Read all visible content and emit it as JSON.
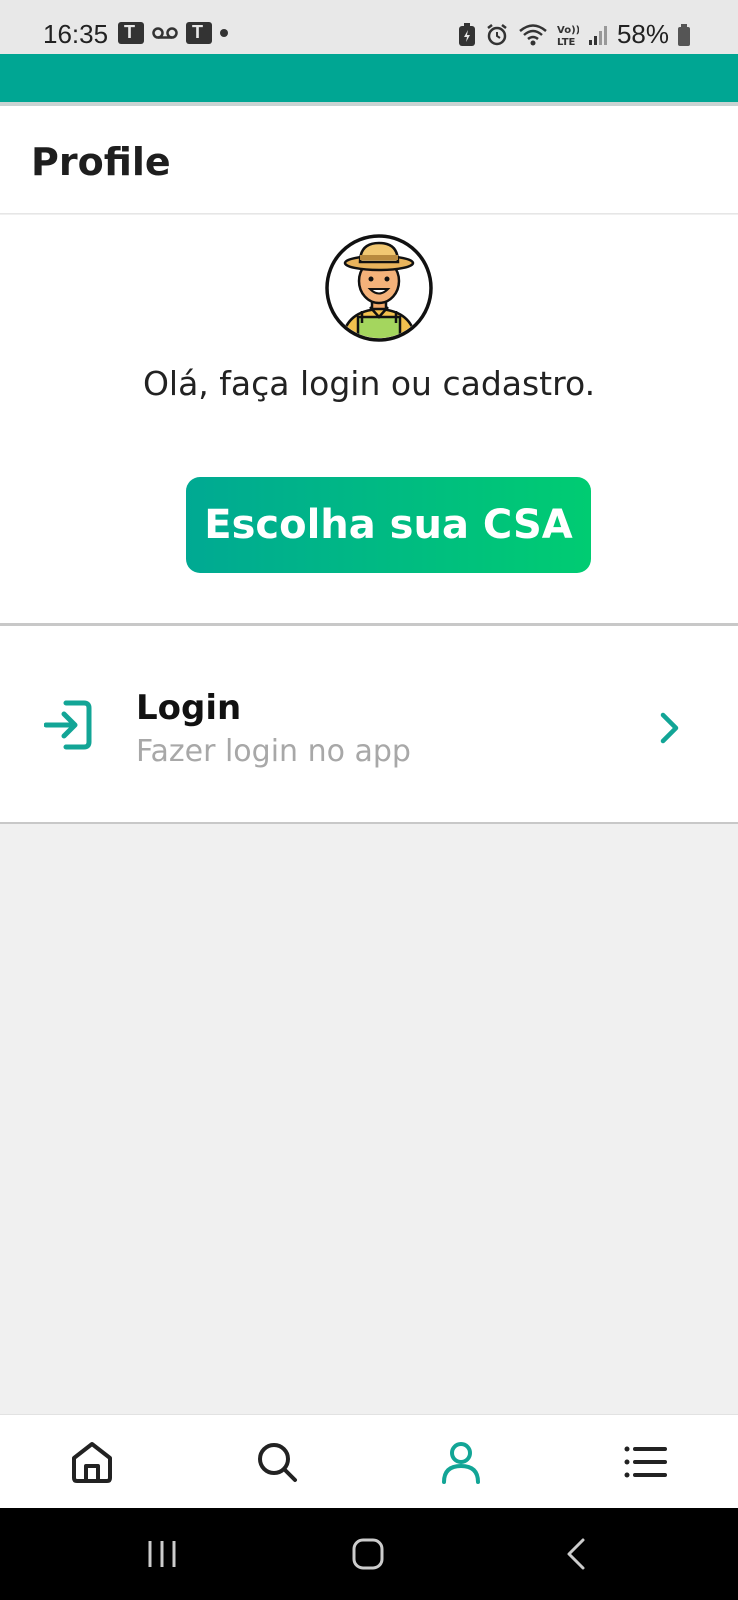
{
  "status_bar": {
    "time": "16:35",
    "battery_text": "58%",
    "left_icons": [
      "teams-icon",
      "voicemail-icon",
      "teams-icon",
      "dot-icon"
    ],
    "right_icons": [
      "battery-saver-icon",
      "alarm-icon",
      "wifi-icon",
      "volte-icon",
      "signal-icon",
      "battery-icon"
    ]
  },
  "header": {
    "title": "Profile"
  },
  "hero": {
    "avatar_icon": "farmer-avatar-icon",
    "greeting": "Olá, faça login ou cadastro.",
    "cta_label": "Escolha sua CSA"
  },
  "menu": {
    "login": {
      "icon": "login-icon",
      "title": "Login",
      "subtitle": "Fazer login no app",
      "chevron": "chevron-right-icon"
    }
  },
  "tabbar": {
    "tabs": [
      {
        "name": "home",
        "icon": "home-icon",
        "active": false
      },
      {
        "name": "search",
        "icon": "search-icon",
        "active": false
      },
      {
        "name": "profile",
        "icon": "user-icon",
        "active": true
      },
      {
        "name": "menu",
        "icon": "list-icon",
        "active": false
      }
    ]
  },
  "colors": {
    "brand_teal": "#00a693",
    "gradient_end": "#00cc72",
    "tab_active": "#12a596",
    "tab_inactive": "#222222"
  }
}
